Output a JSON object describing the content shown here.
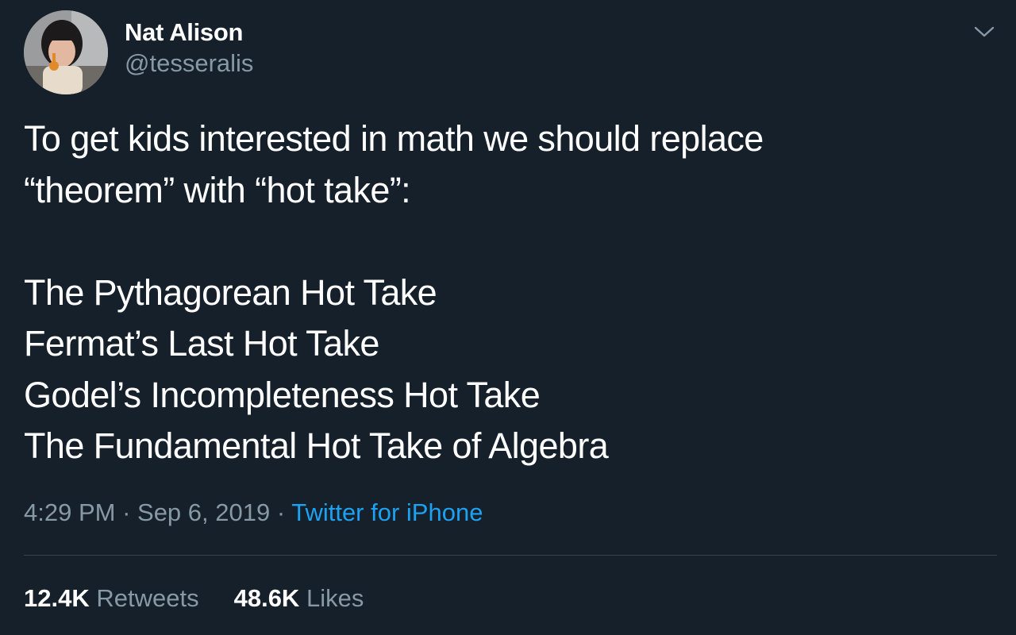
{
  "colors": {
    "background": "#15202b",
    "text_primary": "#ffffff",
    "text_secondary": "#8899a6",
    "link": "#1da1f2",
    "divider": "#38444d"
  },
  "author": {
    "display_name": "Nat Alison",
    "handle": "@tesseralis",
    "avatar_icon": "profile-photo"
  },
  "menu": {
    "icon": "chevron-down-icon"
  },
  "tweet": {
    "lines": [
      "To get kids interested in math we should replace",
      "“theorem” with “hot take”:",
      "",
      "The Pythagorean Hot Take",
      "Fermat’s Last Hot Take",
      "Godel’s Incompleteness Hot Take",
      "The Fundamental Hot Take of Algebra"
    ]
  },
  "meta": {
    "time": "4:29 PM",
    "separator": " · ",
    "date": "Sep 6, 2019",
    "source": "Twitter for iPhone"
  },
  "stats": {
    "retweets_count": "12.4K",
    "retweets_label": "Retweets",
    "likes_count": "48.6K",
    "likes_label": "Likes"
  }
}
